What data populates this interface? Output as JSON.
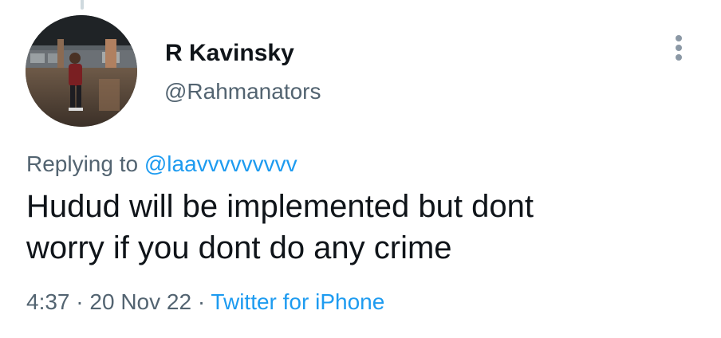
{
  "author": {
    "display_name": "R Kavinsky",
    "handle": "@Rahmanators",
    "avatar_icon": "profile-photo"
  },
  "reply": {
    "prefix": "Replying to",
    "target": "@laavvvvvvvvv"
  },
  "tweet": {
    "text_line1": "Hudud will be implemented but dont",
    "text_line2": "worry if you dont do any crime"
  },
  "meta": {
    "time": "4:37",
    "separator": "·",
    "date": "20 Nov 22",
    "source": "Twitter for iPhone"
  },
  "colors": {
    "text": "#0f1419",
    "secondary": "#536471",
    "link": "#1d9bf0"
  },
  "icons": {
    "more": "more-vertical-icon"
  }
}
